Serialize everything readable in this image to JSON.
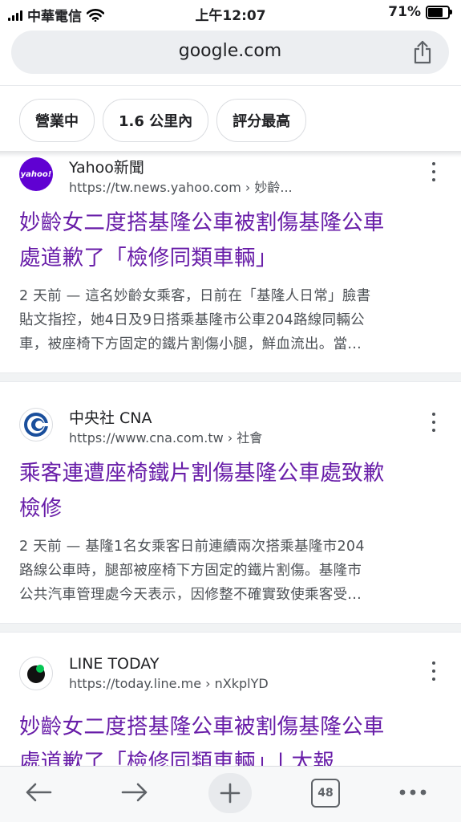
{
  "status_bar": {
    "carrier": "中華電信",
    "time": "上午12:07",
    "battery_percent": "71%",
    "battery_level": 0.71,
    "icons": [
      "signal-icon",
      "wifi-icon",
      "battery-icon"
    ]
  },
  "address_bar": {
    "url": "google.com",
    "share_icon": "share-icon"
  },
  "filter_chips": [
    {
      "label": "營業中"
    },
    {
      "label": "1.6 公里內"
    },
    {
      "label": "評分最高"
    }
  ],
  "results": [
    {
      "source": "Yahoo新聞",
      "favicon_text": "yahoo!",
      "favicon_color": "#6001d2",
      "url": "https://tw.news.yahoo.com › 妙齡...",
      "title_lines": [
        "妙齡女二度搭基隆公車被割傷基隆公車",
        "處道歉了「檢修同類車輛」"
      ],
      "snippet_lines": [
        "2 天前 — 這名妙齡女乘客，日前在「基隆人日常」臉書",
        "貼文指控，她4日及9日搭乘基隆市公車204路線同輛公",
        "車，被座椅下方固定的鐵片割傷小腿，鮮血流出。當..."
      ]
    },
    {
      "source": "中央社 CNA",
      "favicon_color": "#1a4f9c",
      "url": "https://www.cna.com.tw › 社會",
      "title_lines": [
        "乘客連遭座椅鐵片割傷基隆公車處致歉",
        "檢修"
      ],
      "snippet_lines": [
        "2 天前 — 基隆1名女乘客日前連續兩次搭乘基隆市204",
        "路線公車時，腿部被座椅下方固定的鐵片割傷。基隆市",
        "公共汽車管理處今天表示，因修整不確實致使乘客受..."
      ]
    },
    {
      "source": "LINE TODAY",
      "favicon_color": "#06c755",
      "url": "https://today.line.me › nXkplYD",
      "title_lines": [
        "妙齡女二度搭基隆公車被割傷基隆公車",
        "處道歉了「檢修同類車輛」| 太報"
      ],
      "snippet_lines": []
    }
  ],
  "bottom_bar": {
    "tab_count": "48",
    "icons": [
      "back-arrow-icon",
      "forward-arrow-icon",
      "new-tab-plus-icon",
      "tab-switcher-icon",
      "more-options-icon"
    ]
  },
  "colors": {
    "link_visited": "#681da8",
    "snippet_text": "#4d5156",
    "url_bar_bg": "#eceef1"
  }
}
